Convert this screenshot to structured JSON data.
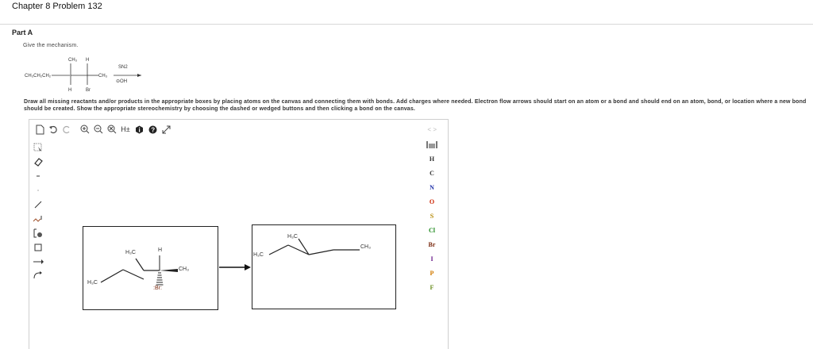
{
  "header": {
    "title": "Chapter 8 Problem 132"
  },
  "part": {
    "label": "Part A",
    "prompt": "Give the mechanism."
  },
  "mechanism": {
    "substituent_top": "CH₃",
    "h_top": "H",
    "left_chain": "CH₃CH₂CH₂",
    "right_group": "CH₃",
    "h_bottom": "H",
    "br_bottom": "Br",
    "condition_top": "SN2",
    "condition_bottom": "⊝OH"
  },
  "instructions": "Draw all missing reactants and/or products in the appropriate boxes by placing atoms on the canvas and connecting them with bonds. Add charges where needed. Electron flow arrows should start on an atom or a bond and should end on an atom, bond, or location where a new bond should be created. Show the appropriate stereochemistry by choosing the dashed or wedged buttons and then clicking a bond on the canvas.",
  "toolbar": {
    "h_toggle": "H±",
    "collapse": "< >"
  },
  "elements": [
    "H",
    "C",
    "N",
    "O",
    "S",
    "Cl",
    "Br",
    "I",
    "P",
    "F"
  ],
  "element_colors": {
    "H": "#333333",
    "C": "#333333",
    "N": "#2233aa",
    "O": "#cc2200",
    "S": "#b38600",
    "Cl": "#1f8a1f",
    "Br": "#7a2a10",
    "I": "#6a1a8a",
    "P": "#d27a00",
    "F": "#6b8e23"
  },
  "canvas": {
    "reactant": {
      "ch3_left": "H₃C",
      "ch3_top": "H₃C",
      "h_atom": "H",
      "ch3_right": "CH₃",
      "br_atom": ":Br:"
    },
    "product": {
      "ch3_left": "H₃C",
      "ch3_top": "H₃C",
      "ch3_right": "CH₃"
    }
  }
}
